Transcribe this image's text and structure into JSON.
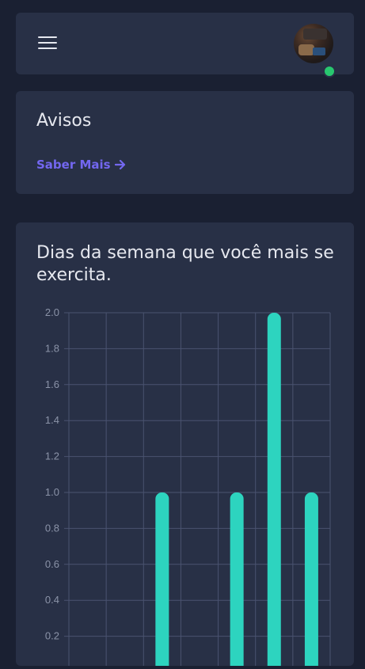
{
  "topbar": {
    "menu_icon": "hamburger-icon",
    "status": "online"
  },
  "avisos": {
    "title": "Avisos",
    "link_label": "Saber Mais",
    "link_icon": "arrow-right-icon"
  },
  "chart_section": {
    "title": "Dias da semana que você mais se exercita."
  },
  "colors": {
    "background": "#1a2032",
    "card": "#283046",
    "accent": "#7367f0",
    "bar": "#2dd4bf",
    "online": "#28c76f"
  },
  "chart_data": {
    "type": "bar",
    "title": "",
    "ylim": [
      0,
      2.0
    ],
    "yticks": [
      "2.0",
      "1.8",
      "1.6",
      "1.4",
      "1.2",
      "1.0",
      "0.8",
      "0.6",
      "0.4",
      "0.2"
    ],
    "values": [
      0,
      0,
      1,
      0,
      1,
      2,
      1
    ],
    "grid": true
  }
}
